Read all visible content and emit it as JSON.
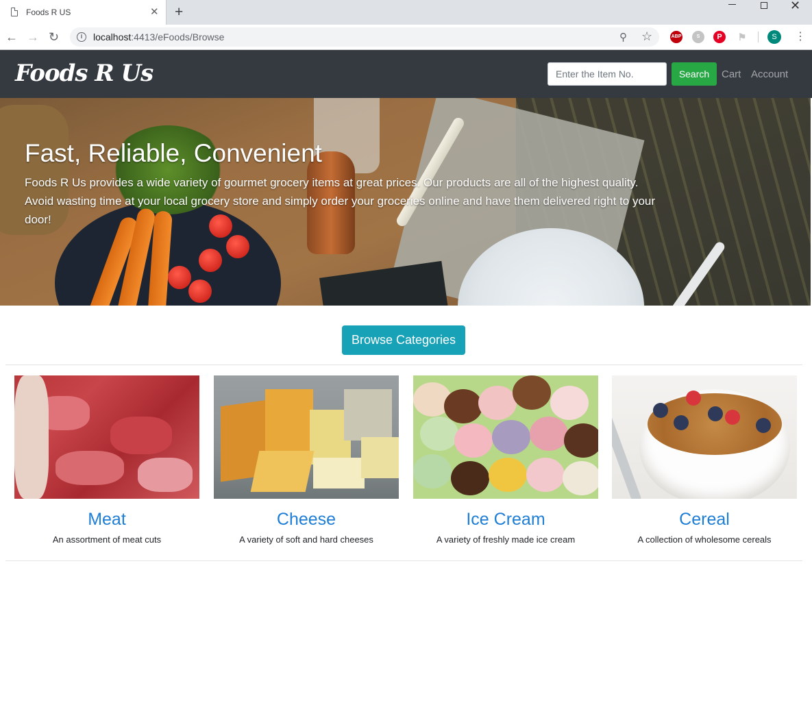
{
  "browser": {
    "tab_title": "Foods R US",
    "url_host": "localhost",
    "url_path": ":4413/eFoods/Browse",
    "profile_initial": "S"
  },
  "site": {
    "brand": "Foods R Us",
    "search_placeholder": "Enter the Item No.",
    "search_label": "Search",
    "cart_label": "Cart",
    "account_label": "Account"
  },
  "hero": {
    "title": "Fast, Reliable, Convenient",
    "description": "Foods R Us provides a wide variety of gourmet grocery items at great prices. Our products are all of the highest quality. Avoid wasting time at your local grocery store and simply order your groceries online and have them delivered right to your door!"
  },
  "browse_button": "Browse Categories",
  "categories": [
    {
      "name": "Meat",
      "description": "An assortment of meat cuts"
    },
    {
      "name": "Cheese",
      "description": "A variety of soft and hard cheeses"
    },
    {
      "name": "Ice Cream",
      "description": "A variety of freshly made ice cream"
    },
    {
      "name": "Cereal",
      "description": "A collection of wholesome cereals"
    }
  ],
  "colors": {
    "navbar": "#343a40",
    "search_button": "#28a745",
    "browse_button": "#17a2b8",
    "category_link": "#1e7ed6"
  }
}
